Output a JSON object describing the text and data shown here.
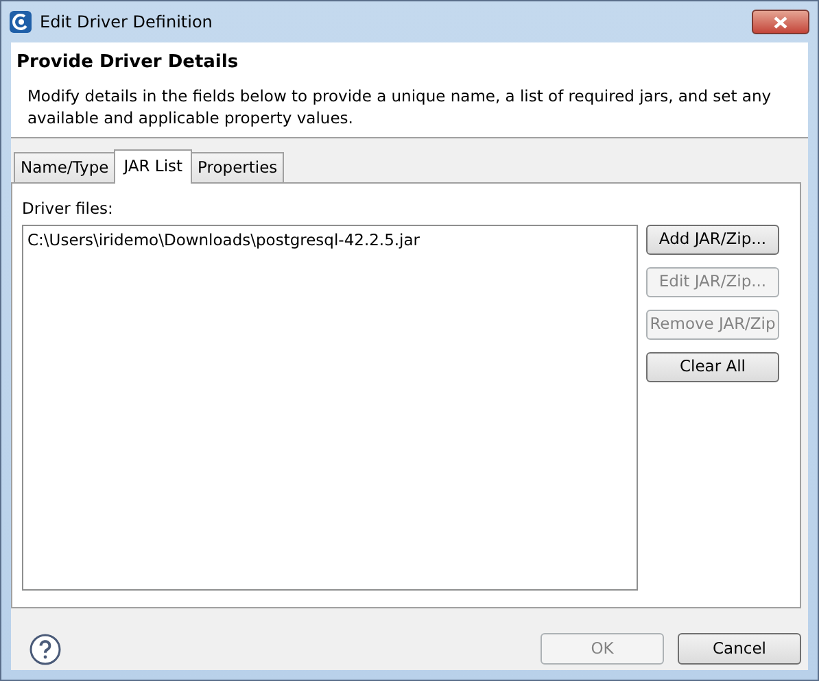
{
  "window": {
    "title": "Edit Driver Definition"
  },
  "header": {
    "title": "Provide Driver Details",
    "description": "Modify details in the fields below to provide a unique name, a list of required jars, and set any available and applicable property values."
  },
  "tabs": [
    {
      "label": "Name/Type",
      "selected": false
    },
    {
      "label": "JAR List",
      "selected": true
    },
    {
      "label": "Properties",
      "selected": false
    }
  ],
  "driver_files": {
    "label": "Driver files:",
    "items": [
      {
        "text": "C:\\Users\\iridemo\\Downloads\\postgresql-42.2.5.jar",
        "selected": false
      }
    ]
  },
  "side_buttons": [
    {
      "label": "Add JAR/Zip...",
      "disabled": false
    },
    {
      "label": "Edit JAR/Zip...",
      "disabled": true
    },
    {
      "label": "Remove JAR/Zip",
      "disabled": true
    },
    {
      "label": "Clear All",
      "disabled": false
    }
  ],
  "footer_buttons": [
    {
      "label": "OK",
      "disabled": true
    },
    {
      "label": "Cancel",
      "disabled": false
    }
  ]
}
